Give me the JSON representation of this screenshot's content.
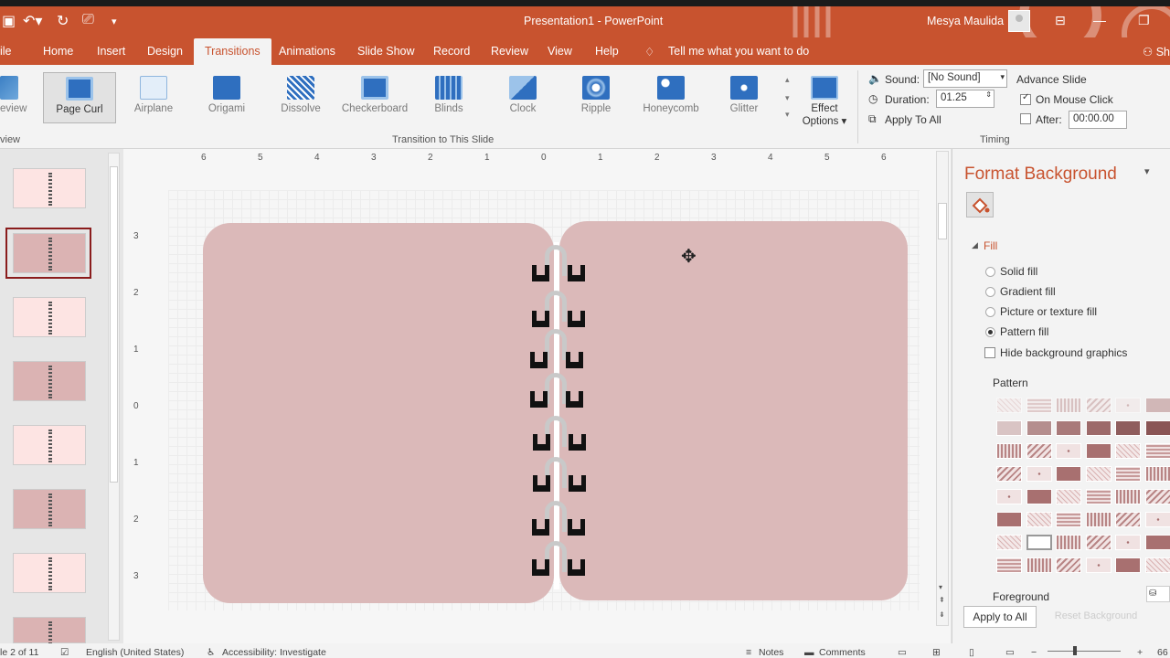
{
  "window": {
    "title": "Presentation1 - PowerPoint",
    "user": "Mesya Maulida"
  },
  "menu": {
    "file": "ile",
    "tabs": [
      "Home",
      "Insert",
      "Design",
      "Transitions",
      "Animations",
      "Slide Show",
      "Record",
      "Review",
      "View",
      "Help"
    ],
    "tell": "Tell me what you want to do",
    "share": "Sh"
  },
  "ribbon": {
    "preview": "eview",
    "preview_group": "view",
    "transitions": [
      "Page Curl",
      "Airplane",
      "Origami",
      "Dissolve",
      "Checkerboard",
      "Blinds",
      "Clock",
      "Ripple",
      "Honeycomb",
      "Glitter"
    ],
    "effect": "Effect",
    "options": "Options",
    "group_label": "Transition to This Slide",
    "timing": {
      "sound_label": "Sound:",
      "sound_value": "[No Sound]",
      "duration_label": "Duration:",
      "duration_value": "01.25",
      "apply_all": "Apply To All",
      "advance": "Advance Slide",
      "on_click": "On Mouse Click",
      "after_label": "After:",
      "after_value": "00:00.00",
      "group_label": "Timing"
    }
  },
  "ruler": {
    "h": [
      "6",
      "5",
      "4",
      "3",
      "2",
      "1",
      "0",
      "1",
      "2",
      "3",
      "4",
      "5",
      "6"
    ],
    "v": [
      "3",
      "2",
      "1",
      "0",
      "1",
      "2",
      "3"
    ]
  },
  "format_pane": {
    "title": "Format Background",
    "section": "Fill",
    "options": [
      "Solid fill",
      "Gradient fill",
      "Picture or texture fill",
      "Pattern fill"
    ],
    "selected": "Pattern fill",
    "hide_bg": "Hide background graphics",
    "pattern_label": "Pattern",
    "foreground_label": "Foreground",
    "apply_all": "Apply to All",
    "reset": "Reset Background"
  },
  "status": {
    "slide": "le 2 of 11",
    "language": "English (United States)",
    "accessibility": "Accessibility: Investigate",
    "notes": "Notes",
    "comments": "Comments",
    "zoom": "66"
  },
  "colors": {
    "accent": "#c8532f",
    "slide_pink": "#dbb9b9"
  }
}
